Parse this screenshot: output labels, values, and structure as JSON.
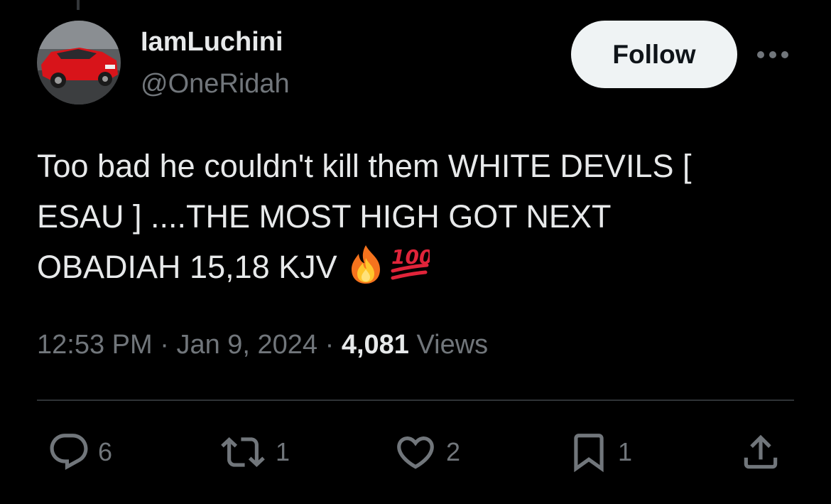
{
  "author": {
    "display_name": "IamLuchini",
    "handle": "@OneRidah"
  },
  "follow_label": "Follow",
  "tweet": {
    "lines": [
      "Too bad he couldn't  kill them WHITE DEVILS [",
      "ESAU ] ....THE MOST HIGH GOT NEXT",
      "OBADIAH 15,18 KJV"
    ],
    "emojis": [
      "fire-emoji",
      "hundred-points-emoji"
    ]
  },
  "meta": {
    "time": "12:53 PM",
    "date": "Jan 9, 2024",
    "separator": "·",
    "views_count": "4,081",
    "views_label": "Views"
  },
  "actions": {
    "replies": "6",
    "reposts": "1",
    "likes": "2",
    "bookmarks": "1"
  },
  "colors": {
    "background": "#000000",
    "text_primary": "#e7e9ea",
    "text_secondary": "#71767b",
    "divider": "#2f3336",
    "follow_bg": "#eff3f4",
    "follow_text": "#0f1419"
  }
}
